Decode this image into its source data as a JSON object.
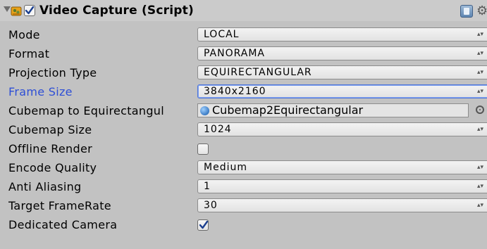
{
  "component": {
    "title": "Video Capture (Script)",
    "enabled": true
  },
  "fields": {
    "mode": {
      "label": "Mode",
      "value": "LOCAL"
    },
    "format": {
      "label": "Format",
      "value": "PANORAMA"
    },
    "projection_type": {
      "label": "Projection Type",
      "value": "EQUIRECTANGULAR"
    },
    "frame_size": {
      "label": "Frame Size",
      "value": "3840x2160"
    },
    "cubemap_to_equirect": {
      "label": "Cubemap to Equirectangul",
      "value": "Cubemap2Equirectangular"
    },
    "cubemap_size": {
      "label": "Cubemap Size",
      "value": "1024"
    },
    "offline_render": {
      "label": "Offline Render",
      "checked": false
    },
    "encode_quality": {
      "label": "Encode Quality",
      "value": "Medium"
    },
    "anti_aliasing": {
      "label": "Anti Aliasing",
      "value": "1"
    },
    "target_framerate": {
      "label": "Target FrameRate",
      "value": "30"
    },
    "dedicated_camera": {
      "label": "Dedicated Camera",
      "checked": true
    }
  },
  "dropdown_arrows": "▴▾",
  "colors": {
    "panel_bg": "#c2c2c2",
    "active_label": "#2e4fd6",
    "focus_border": "#4f76d9"
  },
  "icons": {
    "foldout": "foldout-arrow-icon",
    "script": "script-component-icon",
    "help": "help-book-icon",
    "settings": "gear-icon",
    "object": "material-sphere-icon",
    "picker": "object-picker-icon"
  }
}
